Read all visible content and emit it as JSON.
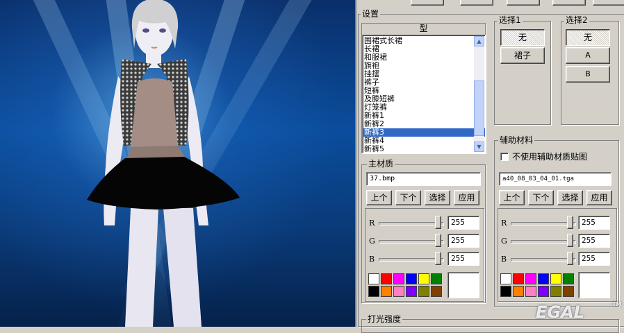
{
  "top_buttons": [
    "",
    "",
    "",
    "",
    ""
  ],
  "settings": {
    "group_label": "设置",
    "type_header": "型",
    "type_list": [
      "围裙式长裙",
      "长裙",
      "和服裙",
      "旗袍",
      "挂摆",
      "裤子",
      "短裤",
      "及膝短裤",
      "灯笼裤",
      "新裤1",
      "新裤2",
      "新裤3",
      "新裤4",
      "新裤5"
    ],
    "selected_index": 11
  },
  "select1": {
    "label": "选择1",
    "options": [
      "无",
      "裙子"
    ],
    "selected": "无"
  },
  "select2": {
    "label": "选择2",
    "options": [
      "无",
      "A",
      "B"
    ],
    "selected": "无"
  },
  "main_material": {
    "label": "主材质",
    "file": "37.bmp",
    "buttons": [
      "上个",
      "下个",
      "选择",
      "应用"
    ],
    "rgb": {
      "labels": [
        "R",
        "G",
        "B"
      ],
      "values": [
        "255",
        "255",
        "255"
      ]
    }
  },
  "aux_material": {
    "label": "辅助材料",
    "checkbox_label": "不使用辅助材质贴图",
    "checked": false,
    "file": "a40_08_03_04_01.tga",
    "buttons": [
      "上个",
      "下个",
      "选择",
      "应用"
    ],
    "rgb": {
      "labels": [
        "R",
        "G",
        "B"
      ],
      "values": [
        "255",
        "255",
        "255"
      ]
    }
  },
  "palette": [
    "#ffffff",
    "#ff0000",
    "#ff00ff",
    "#0000ff",
    "#ffff00",
    "#008000",
    "#000000",
    "#ff8000",
    "#ff80c0",
    "#8000ff",
    "#808000",
    "#804000"
  ],
  "lighting_label": "打光强度",
  "watermark": "EGAL",
  "watermark_tm": "TM"
}
